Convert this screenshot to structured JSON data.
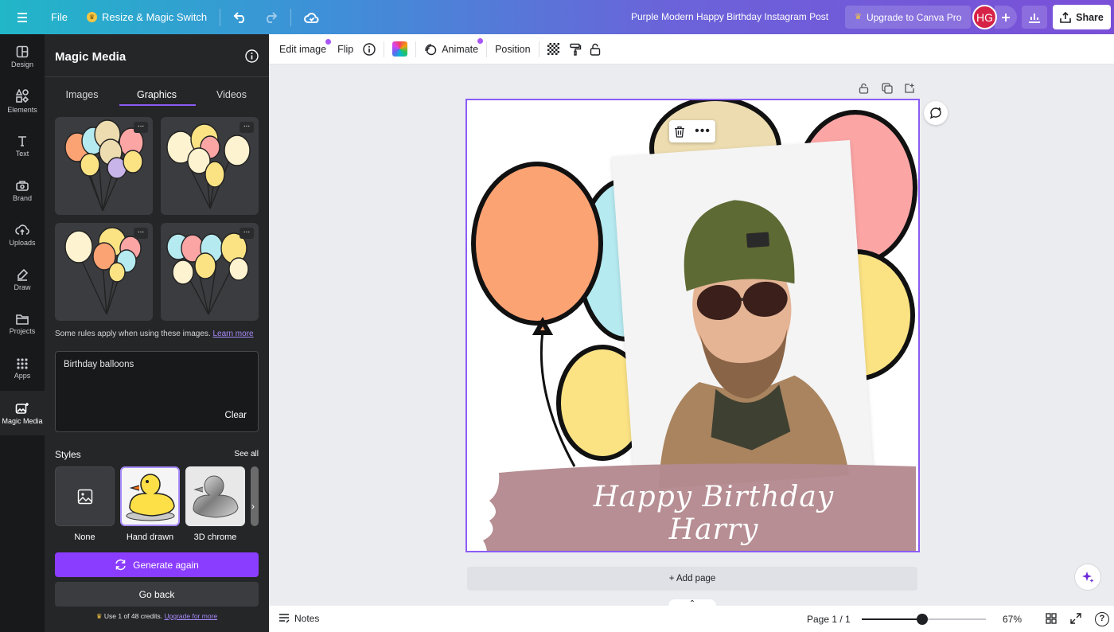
{
  "topbar": {
    "file_label": "File",
    "resize_label": "Resize & Magic Switch",
    "doc_title": "Purple Modern Happy Birthday Instagram Post",
    "upgrade_label": "Upgrade to Canva Pro",
    "avatar_initials": "HG",
    "share_label": "Share"
  },
  "rail": {
    "items": [
      {
        "label": "Design",
        "icon": "design-icon"
      },
      {
        "label": "Elements",
        "icon": "elements-icon"
      },
      {
        "label": "Text",
        "icon": "text-icon"
      },
      {
        "label": "Brand",
        "icon": "brand-icon"
      },
      {
        "label": "Uploads",
        "icon": "uploads-icon"
      },
      {
        "label": "Draw",
        "icon": "draw-icon"
      },
      {
        "label": "Projects",
        "icon": "projects-icon"
      },
      {
        "label": "Apps",
        "icon": "apps-icon"
      },
      {
        "label": "Magic Media",
        "icon": "magic-media-icon"
      }
    ]
  },
  "panel": {
    "title": "Magic Media",
    "tabs": [
      "Images",
      "Graphics",
      "Videos"
    ],
    "active_tab": "Graphics",
    "rules_text": "Some rules apply when using these images.",
    "rules_link": "Learn more",
    "prompt_value": "Birthday balloons",
    "clear_label": "Clear",
    "styles_heading": "Styles",
    "see_all_label": "See all",
    "styles": [
      {
        "label": "None"
      },
      {
        "label": "Hand drawn"
      },
      {
        "label": "3D chrome"
      }
    ],
    "generate_label": "Generate again",
    "go_back_label": "Go back",
    "credits_text": "Use 1 of 48 credits.",
    "credits_link": "Upgrade for more"
  },
  "toolbar": {
    "edit_image": "Edit image",
    "flip": "Flip",
    "animate": "Animate",
    "position": "Position"
  },
  "canvas": {
    "birthday_text": "Happy Birthday Harry",
    "add_page_label": "+ Add page"
  },
  "bottombar": {
    "notes_label": "Notes",
    "page_indicator": "Page 1 / 1",
    "zoom": "67%",
    "zoom_fraction": 0.49
  },
  "colors": {
    "accent": "#8b3dff",
    "balloon_orange": "#fca374",
    "balloon_blue": "#b5eaf0",
    "balloon_yellow": "#fbe384",
    "balloon_pink": "#fca5a5",
    "balloon_tan": "#ecdcb0",
    "brush": "#b48a90"
  }
}
